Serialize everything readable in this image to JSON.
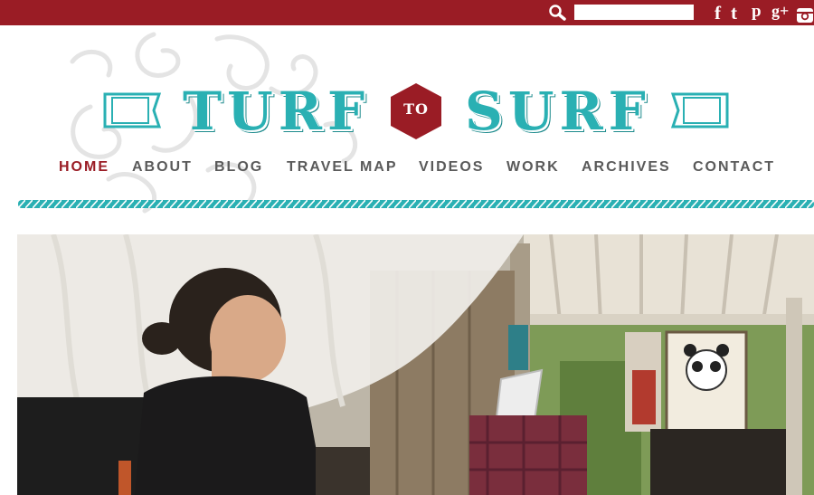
{
  "header": {
    "search": {
      "value": "",
      "placeholder": ""
    },
    "social": {
      "facebook": "f",
      "twitter": "t",
      "pinterest": "p",
      "googleplus": "g+",
      "instagram": "instagram-icon"
    }
  },
  "logo": {
    "word1": "TURF",
    "connector": "TO",
    "word2": "SURF"
  },
  "nav": {
    "items": [
      {
        "label": "HOME",
        "active": true
      },
      {
        "label": "ABOUT",
        "active": false
      },
      {
        "label": "BLOG",
        "active": false
      },
      {
        "label": "TRAVEL MAP",
        "active": false
      },
      {
        "label": "VIDEOS",
        "active": false
      },
      {
        "label": "WORK",
        "active": false
      },
      {
        "label": "ARCHIVES",
        "active": false
      },
      {
        "label": "CONTACT",
        "active": false
      }
    ]
  },
  "colors": {
    "topbar": "#9a1c25",
    "logo_teal": "#2ab0b3",
    "accent_red": "#9a1c25",
    "nav_text": "#5a5a5a"
  }
}
